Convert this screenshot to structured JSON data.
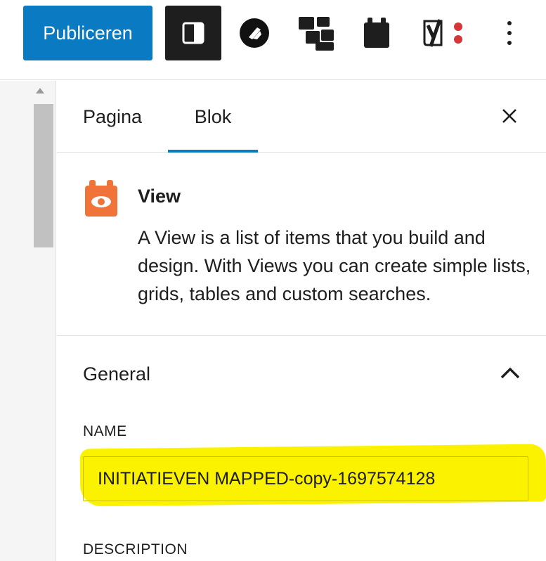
{
  "toolbar": {
    "publish_label": "Publiceren",
    "icons": [
      "sidebar-toggle-icon",
      "brand-circle-icon",
      "blocks-icon",
      "card-icon",
      "yoast-icon",
      "more-vertical-icon"
    ]
  },
  "sidebar": {
    "tabs": [
      {
        "label": "Pagina",
        "active": false
      },
      {
        "label": "Blok",
        "active": true
      }
    ],
    "block": {
      "title": "View",
      "description": "A View is a list of items that you build and design. With Views you can create simple lists, grids, tables and custom searches."
    },
    "general": {
      "title": "General",
      "name_label": "NAME",
      "name_value": "INITIATIEVEN MAPPED-copy-1697574128",
      "description_label": "DESCRIPTION"
    }
  },
  "colors": {
    "accent": "#0a7ac2",
    "block_icon": "#f0733a",
    "highlight": "#fbf200",
    "dark": "#1e1e1e",
    "yoast_dots": "#d63638"
  }
}
